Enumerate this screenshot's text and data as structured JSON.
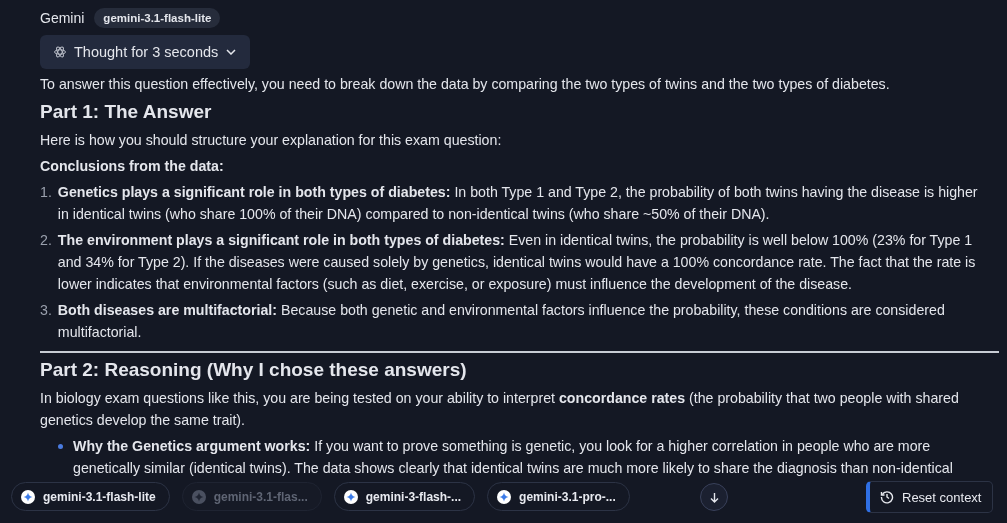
{
  "header": {
    "sender": "Gemini",
    "model_badge": "gemini-3.1-flash-lite"
  },
  "thought": {
    "label": "Thought for 3 seconds",
    "expanded": false
  },
  "content": [
    {
      "kind": "paragraph",
      "text": "To answer this question effectively, you need to break down the data by comparing the two types of twins and the two types of diabetes."
    },
    {
      "kind": "heading",
      "text": "Part 1: The Answer"
    },
    {
      "kind": "paragraph",
      "text": "Here is how you should structure your explanation for this exam question:"
    },
    {
      "kind": "label",
      "text": "Conclusions from the data:"
    },
    {
      "kind": "numbered",
      "number": "1.",
      "text": "**Genetics plays a significant role in both types of diabetes:** In both Type 1 and Type 2, the probability of both twins having the disease is higher in identical twins (who share 100% of their DNA) compared to non-identical twins (who share ~50% of their DNA)."
    },
    {
      "kind": "numbered",
      "number": "2.",
      "text": "**The environment plays a significant role in both types of diabetes:** Even in identical twins, the probability is well below 100% (23% for Type 1 and 34% for Type 2). If the diseases were caused solely by genetics, identical twins would have a 100% concordance rate. The fact that the rate is lower indicates that environmental factors (such as diet, exercise, or exposure) must influence the development of the disease."
    },
    {
      "kind": "numbered",
      "number": "3.",
      "text": "**Both diseases are multifactorial:** Because both genetic and environmental factors influence the probability, these conditions are considered multifactorial."
    },
    {
      "kind": "rule"
    },
    {
      "kind": "heading",
      "text": "Part 2: Reasoning (Why I chose these answers)"
    },
    {
      "kind": "paragraph",
      "text": "In biology exam questions like this, you are being tested on your ability to interpret **concordance rates** (the probability that two people with shared genetics develop the same trait)."
    },
    {
      "kind": "bullet",
      "text": "**Why the Genetics argument works:** If you want to prove something is genetic, you look for a higher correlation in people who are more genetically similar (identical twins). The data shows clearly that identical twins are much more likely to share the diagnosis than non-identical"
    }
  ],
  "model_chips": [
    {
      "label": "gemini-3.1-flash-lite",
      "disabled": false
    },
    {
      "label": "gemini-3.1-flas...",
      "disabled": true
    },
    {
      "label": "gemini-3-flash-...",
      "disabled": false
    },
    {
      "label": "gemini-3.1-pro-...",
      "disabled": false
    }
  ],
  "reset_button": {
    "label": "Reset context"
  }
}
